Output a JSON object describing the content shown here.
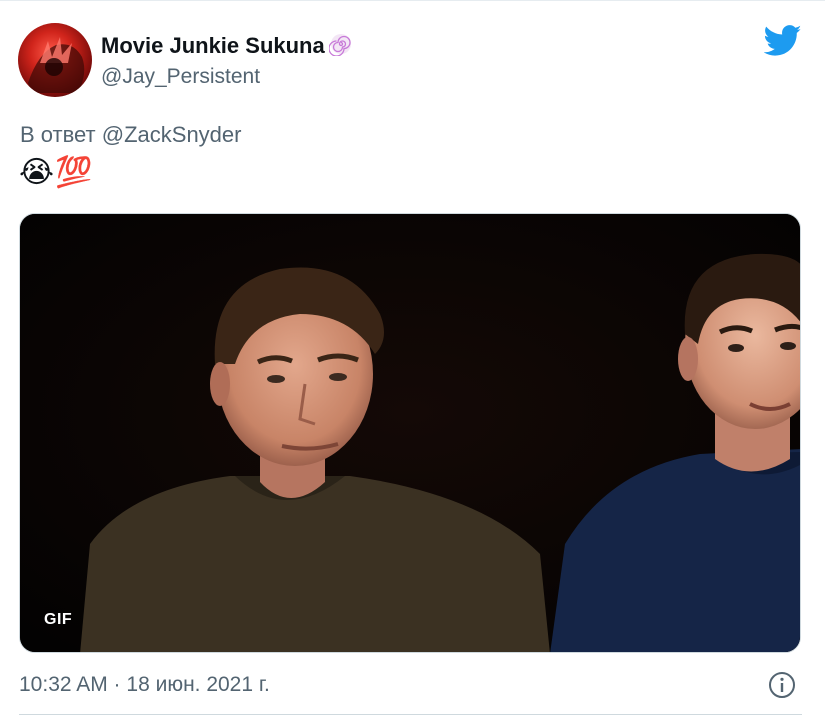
{
  "tweet": {
    "author": {
      "display_name": "Movie Junkie Sukuna",
      "handle": "@Jay_Persistent",
      "badge_icon": "hypnosis-spiral-emoji",
      "avatar": "avatar-red-anime-character"
    },
    "reply_prefix": "В ответ",
    "reply_to": "@ZackSnyder",
    "emojis": [
      "😭",
      "💯"
    ],
    "media": {
      "type": "gif",
      "badge": "GIF"
    },
    "timestamp": "10:32 AM · 18 июн. 2021 г."
  },
  "icons": {
    "brand": "twitter-bird-icon",
    "info": "info-icon"
  },
  "colors": {
    "twitter_blue": "#1d9bf0",
    "secondary_text": "#536471",
    "primary_text": "#0f1419"
  }
}
